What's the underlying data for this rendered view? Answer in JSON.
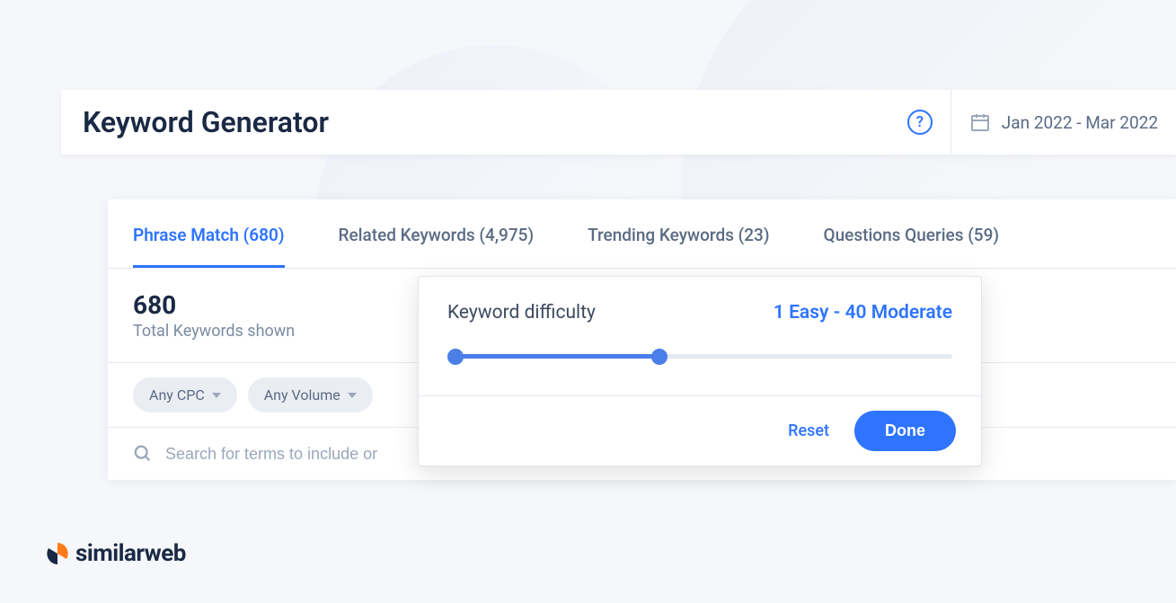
{
  "header": {
    "title": "Keyword Generator",
    "date_range": "Jan 2022 - Mar 2022"
  },
  "tabs": [
    {
      "label": "Phrase Match (680)",
      "active": true
    },
    {
      "label": "Related Keywords (4,975)",
      "active": false
    },
    {
      "label": "Trending Keywords (23)",
      "active": false
    },
    {
      "label": "Questions Queries (59)",
      "active": false
    }
  ],
  "stats": {
    "count": "680",
    "label": "Total Keywords shown"
  },
  "filters": {
    "cpc": "Any CPC",
    "volume": "Any Volume"
  },
  "search": {
    "placeholder": "Search for terms to include or"
  },
  "popover": {
    "label": "Keyword difficulty",
    "value": "1 Easy - 40 Moderate",
    "reset": "Reset",
    "done": "Done"
  },
  "brand": "similarweb"
}
